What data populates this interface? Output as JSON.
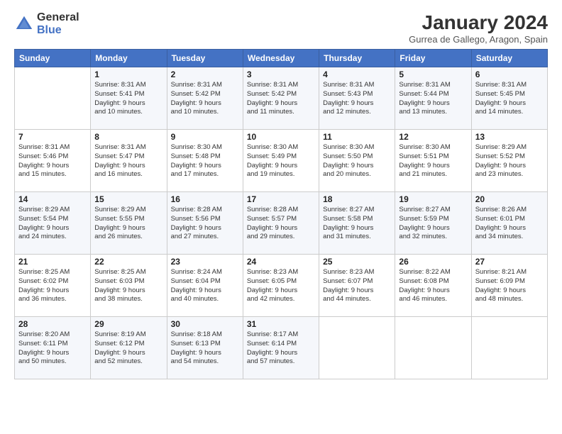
{
  "logo": {
    "general": "General",
    "blue": "Blue"
  },
  "title": "January 2024",
  "location": "Gurrea de Gallego, Aragon, Spain",
  "days_of_week": [
    "Sunday",
    "Monday",
    "Tuesday",
    "Wednesday",
    "Thursday",
    "Friday",
    "Saturday"
  ],
  "weeks": [
    [
      {
        "num": "",
        "lines": []
      },
      {
        "num": "1",
        "lines": [
          "Sunrise: 8:31 AM",
          "Sunset: 5:41 PM",
          "Daylight: 9 hours",
          "and 10 minutes."
        ]
      },
      {
        "num": "2",
        "lines": [
          "Sunrise: 8:31 AM",
          "Sunset: 5:42 PM",
          "Daylight: 9 hours",
          "and 10 minutes."
        ]
      },
      {
        "num": "3",
        "lines": [
          "Sunrise: 8:31 AM",
          "Sunset: 5:42 PM",
          "Daylight: 9 hours",
          "and 11 minutes."
        ]
      },
      {
        "num": "4",
        "lines": [
          "Sunrise: 8:31 AM",
          "Sunset: 5:43 PM",
          "Daylight: 9 hours",
          "and 12 minutes."
        ]
      },
      {
        "num": "5",
        "lines": [
          "Sunrise: 8:31 AM",
          "Sunset: 5:44 PM",
          "Daylight: 9 hours",
          "and 13 minutes."
        ]
      },
      {
        "num": "6",
        "lines": [
          "Sunrise: 8:31 AM",
          "Sunset: 5:45 PM",
          "Daylight: 9 hours",
          "and 14 minutes."
        ]
      }
    ],
    [
      {
        "num": "7",
        "lines": [
          "Sunrise: 8:31 AM",
          "Sunset: 5:46 PM",
          "Daylight: 9 hours",
          "and 15 minutes."
        ]
      },
      {
        "num": "8",
        "lines": [
          "Sunrise: 8:31 AM",
          "Sunset: 5:47 PM",
          "Daylight: 9 hours",
          "and 16 minutes."
        ]
      },
      {
        "num": "9",
        "lines": [
          "Sunrise: 8:30 AM",
          "Sunset: 5:48 PM",
          "Daylight: 9 hours",
          "and 17 minutes."
        ]
      },
      {
        "num": "10",
        "lines": [
          "Sunrise: 8:30 AM",
          "Sunset: 5:49 PM",
          "Daylight: 9 hours",
          "and 19 minutes."
        ]
      },
      {
        "num": "11",
        "lines": [
          "Sunrise: 8:30 AM",
          "Sunset: 5:50 PM",
          "Daylight: 9 hours",
          "and 20 minutes."
        ]
      },
      {
        "num": "12",
        "lines": [
          "Sunrise: 8:30 AM",
          "Sunset: 5:51 PM",
          "Daylight: 9 hours",
          "and 21 minutes."
        ]
      },
      {
        "num": "13",
        "lines": [
          "Sunrise: 8:29 AM",
          "Sunset: 5:52 PM",
          "Daylight: 9 hours",
          "and 23 minutes."
        ]
      }
    ],
    [
      {
        "num": "14",
        "lines": [
          "Sunrise: 8:29 AM",
          "Sunset: 5:54 PM",
          "Daylight: 9 hours",
          "and 24 minutes."
        ]
      },
      {
        "num": "15",
        "lines": [
          "Sunrise: 8:29 AM",
          "Sunset: 5:55 PM",
          "Daylight: 9 hours",
          "and 26 minutes."
        ]
      },
      {
        "num": "16",
        "lines": [
          "Sunrise: 8:28 AM",
          "Sunset: 5:56 PM",
          "Daylight: 9 hours",
          "and 27 minutes."
        ]
      },
      {
        "num": "17",
        "lines": [
          "Sunrise: 8:28 AM",
          "Sunset: 5:57 PM",
          "Daylight: 9 hours",
          "and 29 minutes."
        ]
      },
      {
        "num": "18",
        "lines": [
          "Sunrise: 8:27 AM",
          "Sunset: 5:58 PM",
          "Daylight: 9 hours",
          "and 31 minutes."
        ]
      },
      {
        "num": "19",
        "lines": [
          "Sunrise: 8:27 AM",
          "Sunset: 5:59 PM",
          "Daylight: 9 hours",
          "and 32 minutes."
        ]
      },
      {
        "num": "20",
        "lines": [
          "Sunrise: 8:26 AM",
          "Sunset: 6:01 PM",
          "Daylight: 9 hours",
          "and 34 minutes."
        ]
      }
    ],
    [
      {
        "num": "21",
        "lines": [
          "Sunrise: 8:25 AM",
          "Sunset: 6:02 PM",
          "Daylight: 9 hours",
          "and 36 minutes."
        ]
      },
      {
        "num": "22",
        "lines": [
          "Sunrise: 8:25 AM",
          "Sunset: 6:03 PM",
          "Daylight: 9 hours",
          "and 38 minutes."
        ]
      },
      {
        "num": "23",
        "lines": [
          "Sunrise: 8:24 AM",
          "Sunset: 6:04 PM",
          "Daylight: 9 hours",
          "and 40 minutes."
        ]
      },
      {
        "num": "24",
        "lines": [
          "Sunrise: 8:23 AM",
          "Sunset: 6:05 PM",
          "Daylight: 9 hours",
          "and 42 minutes."
        ]
      },
      {
        "num": "25",
        "lines": [
          "Sunrise: 8:23 AM",
          "Sunset: 6:07 PM",
          "Daylight: 9 hours",
          "and 44 minutes."
        ]
      },
      {
        "num": "26",
        "lines": [
          "Sunrise: 8:22 AM",
          "Sunset: 6:08 PM",
          "Daylight: 9 hours",
          "and 46 minutes."
        ]
      },
      {
        "num": "27",
        "lines": [
          "Sunrise: 8:21 AM",
          "Sunset: 6:09 PM",
          "Daylight: 9 hours",
          "and 48 minutes."
        ]
      }
    ],
    [
      {
        "num": "28",
        "lines": [
          "Sunrise: 8:20 AM",
          "Sunset: 6:11 PM",
          "Daylight: 9 hours",
          "and 50 minutes."
        ]
      },
      {
        "num": "29",
        "lines": [
          "Sunrise: 8:19 AM",
          "Sunset: 6:12 PM",
          "Daylight: 9 hours",
          "and 52 minutes."
        ]
      },
      {
        "num": "30",
        "lines": [
          "Sunrise: 8:18 AM",
          "Sunset: 6:13 PM",
          "Daylight: 9 hours",
          "and 54 minutes."
        ]
      },
      {
        "num": "31",
        "lines": [
          "Sunrise: 8:17 AM",
          "Sunset: 6:14 PM",
          "Daylight: 9 hours",
          "and 57 minutes."
        ]
      },
      {
        "num": "",
        "lines": []
      },
      {
        "num": "",
        "lines": []
      },
      {
        "num": "",
        "lines": []
      }
    ]
  ]
}
